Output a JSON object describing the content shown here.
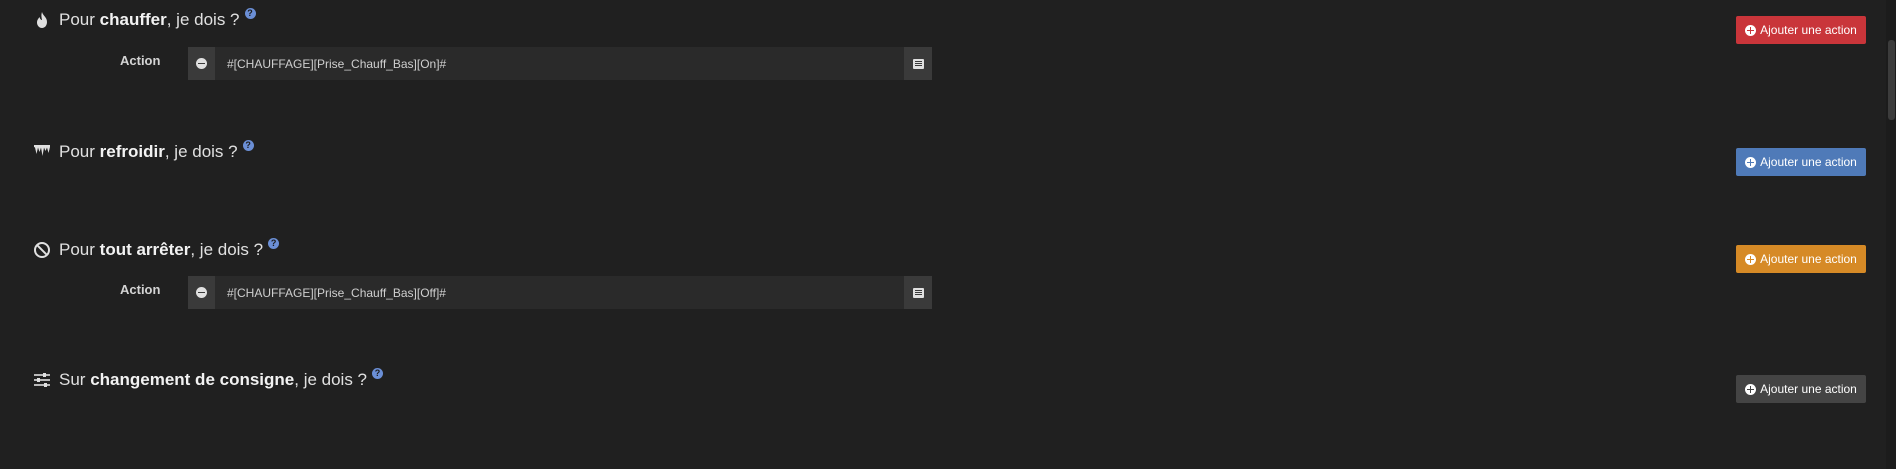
{
  "sections": [
    {
      "prefix": "Pour ",
      "bold": "chauffer",
      "suffix": ", je dois ?",
      "icon": "flame-icon",
      "help": "?",
      "button": "Ajouter une action",
      "button_color": "#c9353a",
      "actions": [
        {
          "label": "Action",
          "value": "#[CHAUFFAGE][Prise_Chauff_Bas][On]#"
        }
      ]
    },
    {
      "prefix": "Pour ",
      "bold": "refroidir",
      "suffix": ", je dois ?",
      "icon": "icicles-icon",
      "help": "?",
      "button": "Ajouter une action",
      "button_color": "#4f7ab8",
      "actions": []
    },
    {
      "prefix": "Pour ",
      "bold": "tout arrêter",
      "suffix": ", je dois ?",
      "icon": "ban-icon",
      "help": "?",
      "button": "Ajouter une action",
      "button_color": "#d68a26",
      "actions": [
        {
          "label": "Action",
          "value": "#[CHAUFFAGE][Prise_Chauff_Bas][Off]#"
        }
      ]
    },
    {
      "prefix": "Sur ",
      "bold": "changement de consigne",
      "suffix": ", je dois ?",
      "icon": "sliders-icon",
      "help": "?",
      "button": "Ajouter une action",
      "button_color": "#444444",
      "actions": []
    }
  ]
}
